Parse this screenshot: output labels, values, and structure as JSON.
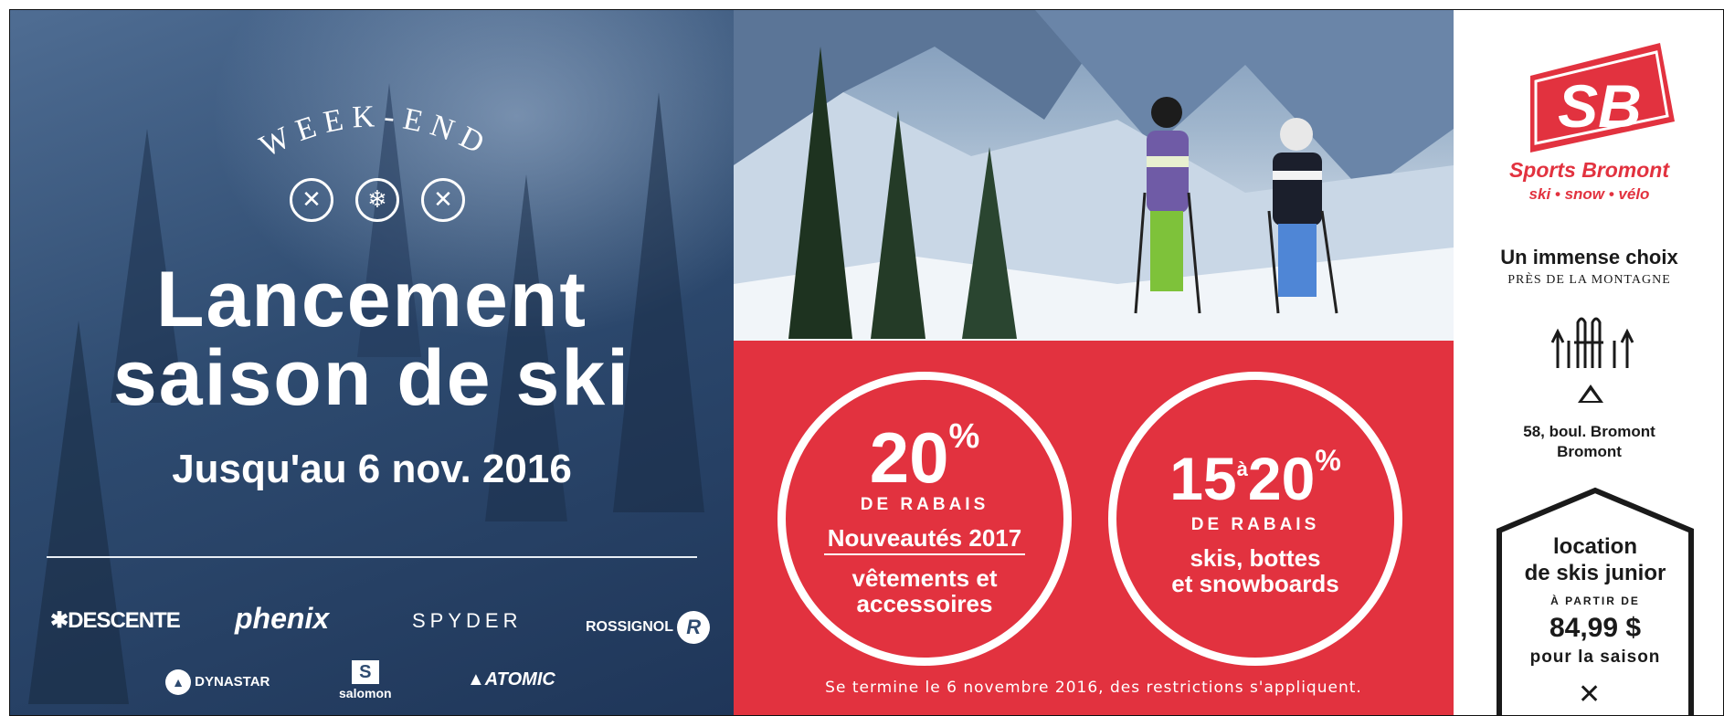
{
  "left": {
    "weekend": "WEEK-END",
    "emblems": [
      "crossed-poles-icon",
      "snowflake-icon",
      "crossed-skis-icon"
    ],
    "title_line1": "Lancement",
    "title_line2": "saison de ski",
    "until": "Jusqu'au 6 nov. 2016",
    "brands_row1": [
      "DESCENTE",
      "phenix",
      "SPYDER",
      "ROSSIGNOL"
    ],
    "brands_row2": [
      "DYNASTAR",
      "salomon",
      "ATOMIC"
    ]
  },
  "promo": {
    "circle1": {
      "value": "20",
      "unit": "%",
      "rabais": "DE RABAIS",
      "headline": "Nouveautés 2017",
      "desc_line1": "vêtements et",
      "desc_line2": "accessoires"
    },
    "circle2": {
      "value_from": "15",
      "connector": "à",
      "value_to": "20",
      "unit": "%",
      "rabais": "DE RABAIS",
      "desc_line1": "skis, bottes",
      "desc_line2": "et snowboards"
    },
    "footer": "Se termine le 6 novembre 2016, des restrictions s'appliquent."
  },
  "store": {
    "logo_text": "SB",
    "name": "Sports Bromont",
    "tagline": "ski • snow • vélo",
    "choice": "Un immense choix",
    "near": "PRÈS DE LA MONTAGNE",
    "address_line1": "58, boul. Bromont",
    "address_line2": "Bromont",
    "badge": {
      "line1": "location",
      "line2": "de skis junior",
      "from": "À PARTIR DE",
      "price": "84,99 $",
      "per": "pour la saison"
    }
  },
  "colors": {
    "red": "#e2323f",
    "navy": "#2e4b70",
    "white": "#ffffff"
  }
}
